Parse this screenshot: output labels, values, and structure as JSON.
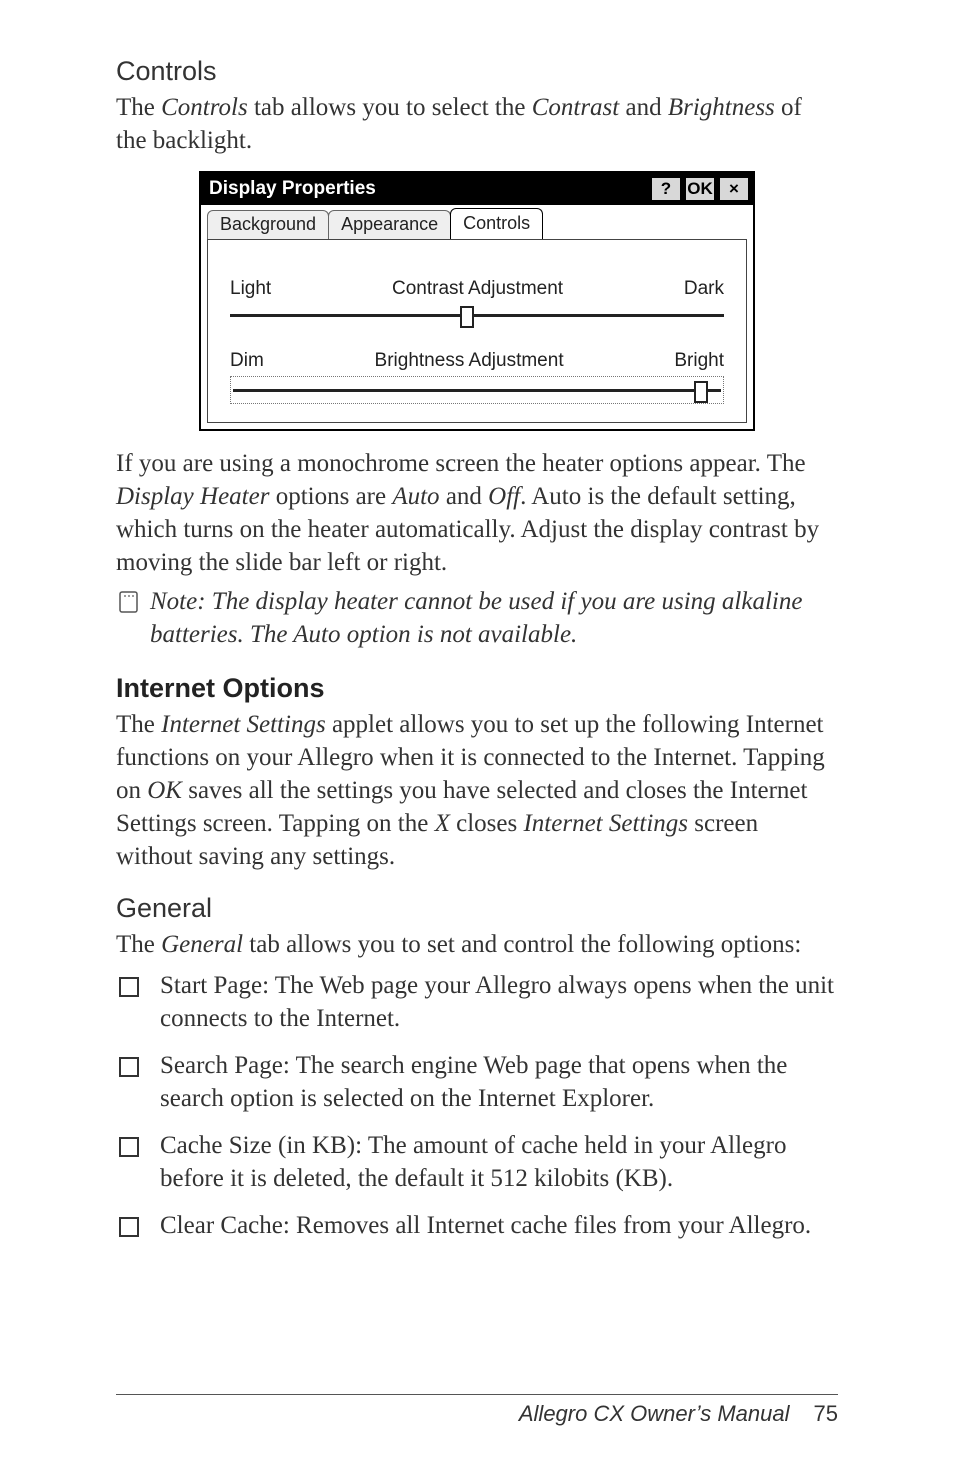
{
  "section1": {
    "heading": "Controls",
    "intro_parts": [
      "The ",
      "Controls",
      " tab allows you to select the ",
      "Contrast",
      " and ",
      "Brightness",
      " of the backlight."
    ]
  },
  "dialog": {
    "title": "Display Properties",
    "buttons": {
      "help": "?",
      "ok": "OK",
      "close": "×"
    },
    "tabs": {
      "background": "Background",
      "appearance": "Appearance",
      "controls": "Controls"
    },
    "contrast": {
      "left": "Light",
      "center": "Contrast Adjustment",
      "right": "Dark",
      "thumb_pct": 48
    },
    "brightness": {
      "left": "Dim",
      "center": "Brightness Adjustment",
      "right": "Bright",
      "thumb_pct": 96
    }
  },
  "section2": {
    "para_parts": [
      "If you are using a monochrome screen the heater options appear. The ",
      "Display Heater",
      " options are ",
      "Auto",
      " and ",
      "Off",
      ". Auto is the default setting, which turns on the heater automatically. Adjust the display contrast by moving the slide bar left or right."
    ],
    "note": "Note: The display heater cannot be used if you are using alkaline batteries. The Auto option is not available."
  },
  "section3": {
    "heading": "Internet Options",
    "intro_parts": [
      "The ",
      "Internet Settings",
      " applet allows you to set up the following Internet functions on your Allegro when it is connected to the Internet. Tapping on ",
      "OK",
      " saves all the settings you have selected and closes the Internet Settings screen. Tapping on the ",
      "X",
      " closes ",
      "Internet Settings",
      " screen without saving any settings."
    ]
  },
  "section4": {
    "heading": "General",
    "intro_parts": [
      "The ",
      "General",
      " tab allows you to set and control the following options:"
    ],
    "items": [
      "Start Page: The Web page your Allegro always opens when the unit connects to the Internet.",
      "Search Page: The search engine Web page that opens when the search option is selected on the Internet Explorer.",
      "Cache Size (in KB): The amount of cache held in your Allegro before it is deleted, the default it 512 kilobits (KB).",
      "Clear Cache: Removes all Internet cache files from your Allegro."
    ]
  },
  "footer": {
    "title": "Allegro CX Owner’s Manual",
    "page": "75"
  }
}
